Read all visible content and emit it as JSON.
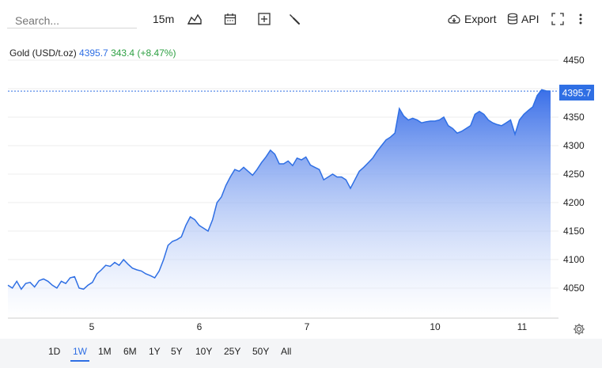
{
  "toolbar": {
    "search_placeholder": "Search...",
    "interval": "15m",
    "export_label": "Export",
    "api_label": "API",
    "icons": [
      "chart-type-icon",
      "calendar-icon",
      "add-indicator-icon",
      "wrench-icon",
      "cloud-download-icon",
      "database-icon",
      "fullscreen-icon",
      "more-icon"
    ]
  },
  "legend": {
    "name": "Gold (USD/t.oz)",
    "price": "4395.7",
    "change": "343.4 (+8.47%)"
  },
  "price_tag": "4395.7",
  "colors": {
    "accent": "#2f6fe4",
    "positive": "#2ea043",
    "area_top": "#3a6fe8",
    "area_bottom": "#ffffff"
  },
  "ranges": [
    "1D",
    "1W",
    "1M",
    "6M",
    "1Y",
    "5Y",
    "10Y",
    "25Y",
    "50Y",
    "All"
  ],
  "active_range": "1W",
  "chart_data": {
    "type": "area",
    "title": "Gold (USD/t.oz)",
    "xlabel": "",
    "ylabel": "",
    "x_ticks": [
      "5",
      "6",
      "7",
      "10",
      "11"
    ],
    "y_ticks": [
      4050,
      4100,
      4150,
      4200,
      4250,
      4300,
      4350,
      4400,
      4450
    ],
    "y_tick_labels": [
      "4050",
      "4100",
      "4150",
      "4200",
      "4250",
      "4300",
      "4350",
      "",
      "4450"
    ],
    "ylim": [
      4000,
      4475
    ],
    "last_value": 4395.7,
    "grid": true,
    "series": [
      {
        "values": [
          4055,
          4050,
          4062,
          4048,
          4058,
          4060,
          4052,
          4063,
          4066,
          4062,
          4055,
          4050,
          4062,
          4058,
          4068,
          4070,
          4050,
          4048,
          4055,
          4060,
          4075,
          4082,
          4090,
          4088,
          4095,
          4090,
          4100,
          4092,
          4085,
          4082,
          4080,
          4075,
          4072,
          4068,
          4080,
          4100,
          4125,
          4132,
          4135,
          4140,
          4160,
          4175,
          4170,
          4160,
          4155,
          4150,
          4170,
          4200,
          4210,
          4230,
          4245,
          4258,
          4255,
          4262,
          4255,
          4248,
          4258,
          4270,
          4280,
          4292,
          4285,
          4268,
          4268,
          4273,
          4265,
          4278,
          4275,
          4280,
          4266,
          4262,
          4258,
          4240,
          4245,
          4250,
          4245,
          4245,
          4240,
          4225,
          4240,
          4255,
          4262,
          4270,
          4278,
          4290,
          4300,
          4310,
          4315,
          4322,
          4365,
          4352,
          4345,
          4348,
          4345,
          4340,
          4342,
          4343,
          4343,
          4345,
          4350,
          4335,
          4330,
          4322,
          4325,
          4330,
          4335,
          4355,
          4360,
          4355,
          4345,
          4340,
          4337,
          4335,
          4340,
          4345,
          4320,
          4345,
          4355,
          4362,
          4368,
          4388,
          4398,
          4396,
          4395.7
        ]
      }
    ]
  }
}
